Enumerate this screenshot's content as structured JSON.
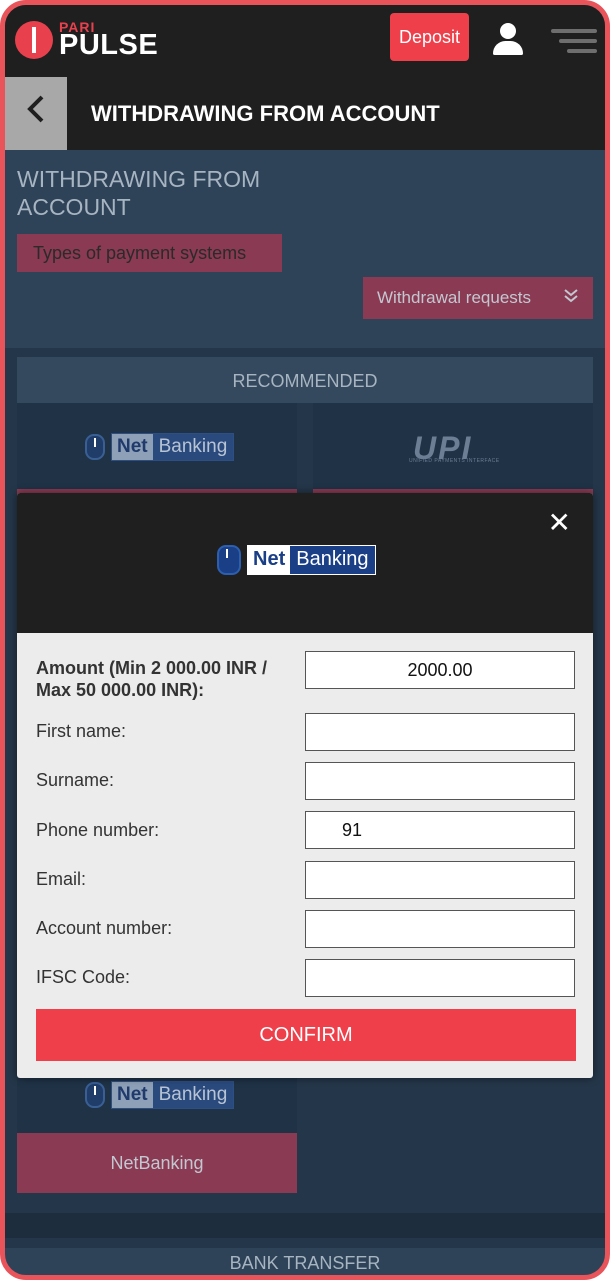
{
  "topbar": {
    "logo_pari": "PARI",
    "logo_pulse": "PULSE",
    "deposit_label": "Deposit"
  },
  "header": {
    "title": "WITHDRAWING FROM ACCOUNT"
  },
  "content": {
    "page_title": "WITHDRAWING FROM ACCOUNT",
    "types_label": "Types of payment systems",
    "requests_label": "Withdrawal requests",
    "recommended_label": "RECOMMENDED",
    "upi_label": "UPI",
    "upi_sub": "UNIFIED PAYMENTS INTERFACE",
    "netbanking_caption": "NetBanking",
    "bank_transfer_label": "BANK TRANSFER"
  },
  "netbanking_logo": {
    "net": "Net",
    "banking": "Banking"
  },
  "modal": {
    "close_symbol": "✕",
    "fields": [
      {
        "label": "Amount (Min 2 000.00 INR / Max 50 000.00 INR):",
        "value": "2000.00"
      },
      {
        "label": "First name:",
        "value": ""
      },
      {
        "label": "Surname:",
        "value": ""
      },
      {
        "label": "Phone number:",
        "value": "91"
      },
      {
        "label": "Email:",
        "value": ""
      },
      {
        "label": "Account number:",
        "value": ""
      },
      {
        "label": "IFSC Code:",
        "value": ""
      }
    ],
    "confirm_label": "CONFIRM"
  },
  "colors": {
    "accent": "#ee3f4a",
    "frame": "#e8545a",
    "dark_bar": "#1f1f1f",
    "background": "#2e4358",
    "tag": "#8a3a53"
  }
}
